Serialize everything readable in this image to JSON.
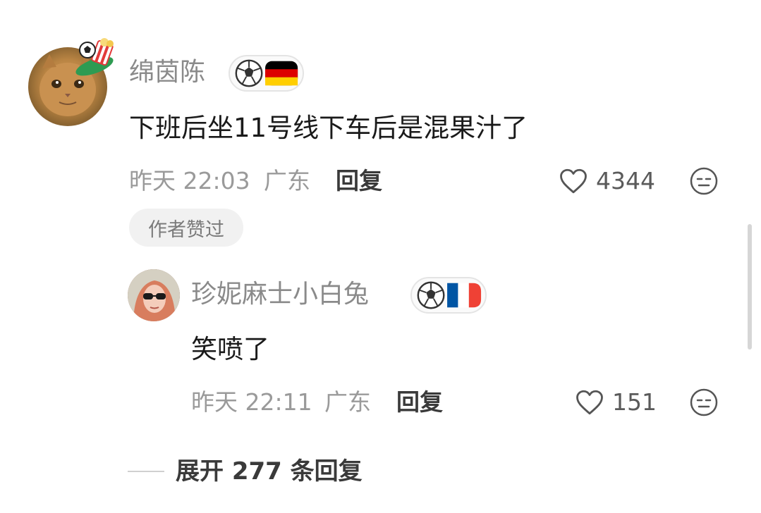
{
  "comment": {
    "username": "绵茵陈",
    "text": "下班后坐11号线下车后是混果汁了",
    "time": "昨天 22:03",
    "location": "广东",
    "reply_label": "回复",
    "likes": "4344",
    "author_liked_label": "作者赞过",
    "badge_flag": "germany-flag",
    "avatar_icon": "cat-avatar"
  },
  "reply": {
    "username": "珍妮麻士小白兔",
    "text": "笑喷了",
    "time": "昨天 22:11",
    "location": "广东",
    "reply_label": "回复",
    "likes": "151",
    "badge_flag": "france-flag",
    "avatar_icon": "user-avatar"
  },
  "expand": {
    "label": "展开 277 条回复"
  },
  "colors": {
    "username": "#8a8a8a",
    "content": "#1a1a1a",
    "meta": "#9a9a9a",
    "germany": [
      "#000000",
      "#dd0000",
      "#ffce00"
    ],
    "france": [
      "#0055a4",
      "#ffffff",
      "#ef4135"
    ]
  }
}
